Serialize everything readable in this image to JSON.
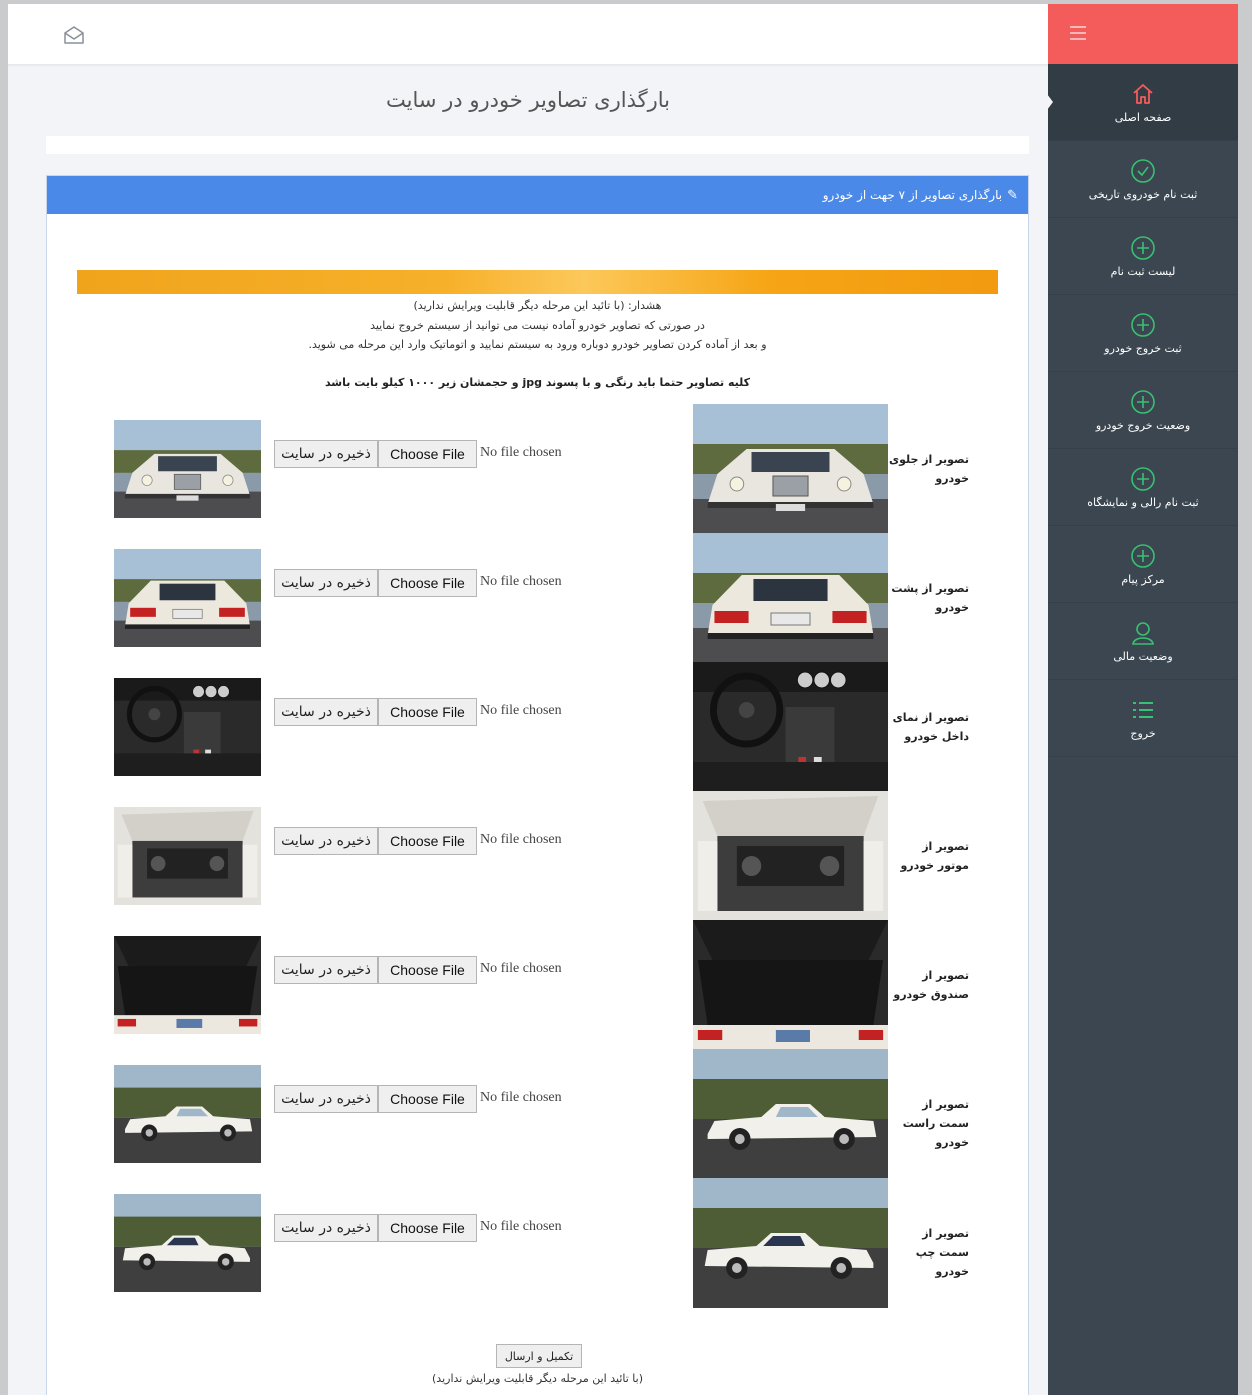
{
  "page": {
    "title": "بارگذاری تصاویر خودرو در سایت"
  },
  "sidebar": {
    "items": [
      {
        "label": "صفحه اصلی",
        "icon": "home-icon"
      },
      {
        "label": "ثبت نام خودروی تاریخی",
        "icon": "check-circle-icon"
      },
      {
        "label": "لیست ثبت نام",
        "icon": "plus-circle-icon"
      },
      {
        "label": "ثبت خروج خودرو",
        "icon": "plus-circle-icon"
      },
      {
        "label": "وضعیت خروج خودرو",
        "icon": "plus-circle-icon"
      },
      {
        "label": "ثبت نام رالی و نمایشگاه",
        "icon": "plus-circle-icon"
      },
      {
        "label": "مرکز پیام",
        "icon": "plus-circle-icon"
      },
      {
        "label": "وضعیت مالی",
        "icon": "user-icon"
      },
      {
        "label": "خروج",
        "icon": "list-icon"
      }
    ],
    "colors": {
      "top": "#f45c5c",
      "bg": "#3b4650",
      "accent": "#38c172",
      "home": "#f45c5c"
    }
  },
  "panel": {
    "heading": "بارگذاری تصاویر از ۷ جهت از خودرو",
    "warning": [
      "هشدار: (با تائید این مرحله دیگر قابلیت ویرایش ندارید)",
      "در صورتی که تصاویر خودرو آماده نیست می توانید از سیستم خروج نمایید",
      "و بعد از آماده کردن تصاویر خودرو دوباره ورود به سیستم نمایید و اتوماتیک وارد این مرحله می شوید."
    ],
    "rule": "کلیه تصاویر حتما باید رنگی و با پسوند jpg و حجمشان زیر ۱۰۰۰ کیلو بایت باشد",
    "save_label": "ذخیره در سایت",
    "choose_label": "Choose File",
    "no_file": "No file chosen",
    "rows": [
      {
        "caption": "تصویر از جلوی خودرو",
        "view": "front"
      },
      {
        "caption": "تصویر از پشت خودرو",
        "view": "rear"
      },
      {
        "caption": "تصویر از نمای داخل خودرو",
        "view": "interior"
      },
      {
        "caption": "تصویر از موتور خودرو",
        "view": "engine"
      },
      {
        "caption": "تصویر از صندوق خودرو",
        "view": "trunk"
      },
      {
        "caption": "تصویر از سمت راست خودرو",
        "view": "right"
      },
      {
        "caption": "تصویر از سمت چپ خودرو",
        "view": "left"
      }
    ],
    "submit_label": "تکمیل و ارسال",
    "submit_note": "(با تائید این مرحله دیگر قابلیت ویرایش ندارید)"
  }
}
